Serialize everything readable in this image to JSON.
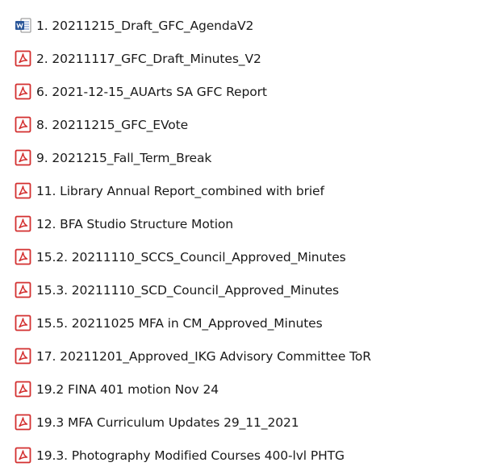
{
  "files": [
    {
      "name": "1. 20211215_Draft_GFC_AgendaV2",
      "icon": "word-doc-icon"
    },
    {
      "name": "2. 20211117_GFC_Draft_Minutes_V2",
      "icon": "pdf-icon"
    },
    {
      "name": "6. 2021-12-15_AUArts SA GFC Report",
      "icon": "pdf-icon"
    },
    {
      "name": "8. 20211215_GFC_EVote",
      "icon": "pdf-icon"
    },
    {
      "name": "9. 2021215_Fall_Term_Break",
      "icon": "pdf-icon"
    },
    {
      "name": "11. Library Annual Report_combined with brief",
      "icon": "pdf-icon"
    },
    {
      "name": "12. BFA Studio Structure Motion",
      "icon": "pdf-icon"
    },
    {
      "name": "15.2. 20211110_SCCS_Council_Approved_Minutes",
      "icon": "pdf-icon"
    },
    {
      "name": "15.3. 20211110_SCD_Council_Approved_Minutes",
      "icon": "pdf-icon"
    },
    {
      "name": "15.5. 20211025 MFA in CM_Approved_Minutes",
      "icon": "pdf-icon"
    },
    {
      "name": "17. 20211201_Approved_IKG Advisory Committee ToR",
      "icon": "pdf-icon"
    },
    {
      "name": "19.2 FINA 401 motion Nov 24",
      "icon": "pdf-icon"
    },
    {
      "name": "19.3 MFA Curriculum Updates 29_11_2021",
      "icon": "pdf-icon"
    },
    {
      "name": "19.3. Photography Modified Courses 400-lvl PHTG",
      "icon": "pdf-icon"
    }
  ],
  "colors": {
    "pdf_red": "#d32f2f",
    "word_blue": "#2b579a",
    "text": "#1a1a1a"
  }
}
